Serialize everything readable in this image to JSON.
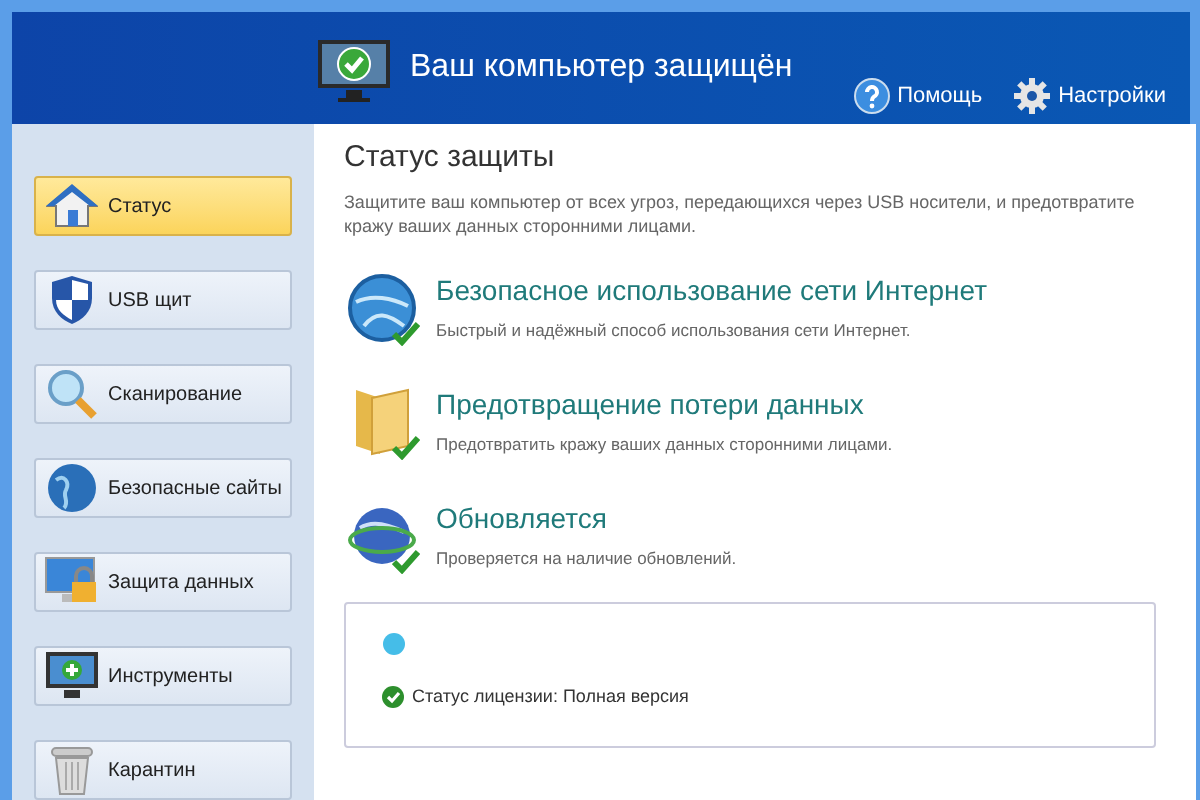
{
  "header": {
    "title": "Ваш компьютер защищён",
    "links": [
      {
        "kind": "help",
        "label": "Помощь"
      },
      {
        "kind": "settings",
        "label": "Настройки"
      }
    ]
  },
  "sidebar": {
    "items": [
      {
        "kind": "home",
        "label": "Статус",
        "selected": true
      },
      {
        "kind": "shield",
        "label": "USB щит",
        "selected": false
      },
      {
        "kind": "scan",
        "label": "Сканирование",
        "selected": false
      },
      {
        "kind": "globe",
        "label": "Безопасные сайты",
        "selected": false
      },
      {
        "kind": "lock",
        "label": "Защита данных",
        "selected": false
      },
      {
        "kind": "tools",
        "label": "Инструменты",
        "selected": false
      },
      {
        "kind": "trash",
        "label": "Карантин",
        "selected": false
      }
    ]
  },
  "main": {
    "title": "Статус защиты",
    "description": "Защитите ваш компьютер от всех угроз, передающихся через USB носители, и предотвратите кражу ваших данных сторонними лицами.",
    "features": [
      {
        "kind": "globe",
        "title": "Безопасное использование сети Интернет",
        "subtitle": "Быстрый и надёжный способ использования сети Интернет."
      },
      {
        "kind": "folder",
        "title": "Предотвращение потери данных",
        "subtitle": "Предотвратить кражу ваших данных сторонними лицами."
      },
      {
        "kind": "update",
        "title": "Обновляется",
        "subtitle": "Проверяется на наличие обновлений."
      }
    ],
    "license": {
      "status": "Статус лицензии: Полная версия"
    }
  }
}
